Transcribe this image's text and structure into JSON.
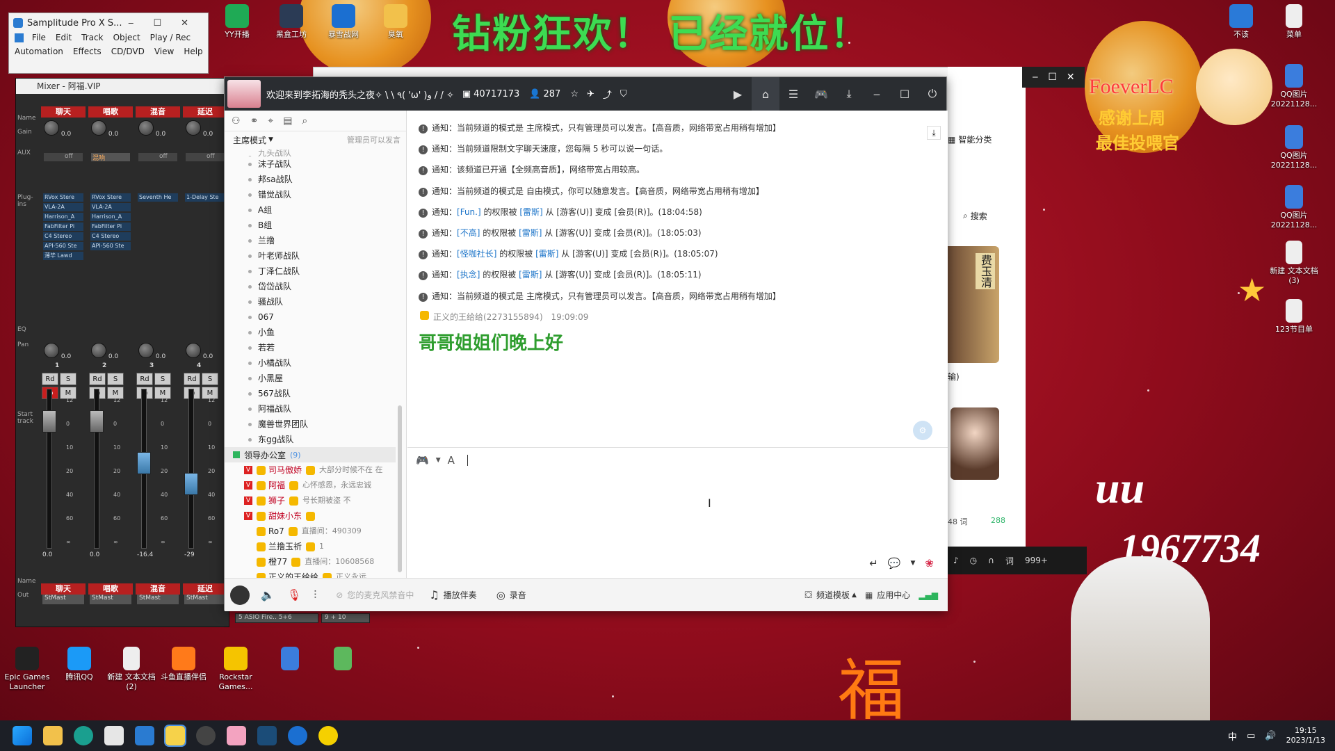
{
  "banner": {
    "text": "钻粉狂欢！ 已经就位！"
  },
  "overlay": {
    "name": "FoeverLC",
    "line1": "感谢上周",
    "line2": "最佳投喂官",
    "big_text1": "uu",
    "big_text2": "1967734",
    "fu": "福"
  },
  "desktop_top": [
    {
      "label": "YY开播",
      "color": "#1faa55"
    },
    {
      "label": "黑盒工坊",
      "color": "#2b3b55"
    },
    {
      "label": "暴雪战网",
      "color": "#1b6fd1"
    },
    {
      "label": "臭氧",
      "color": "#f2c14b"
    }
  ],
  "desktop_right": [
    {
      "label": "不该",
      "color": "#2a7ad8"
    },
    {
      "label": "菜单",
      "color": "#eeeeee"
    },
    {
      "label": "QQ图片20221128...",
      "color": "#3b7ddd"
    },
    {
      "label": "QQ图片20221128...",
      "color": "#3b7ddd"
    },
    {
      "label": "QQ图片20221128...",
      "color": "#3b7ddd"
    },
    {
      "label": "新建 文本文档 (3)",
      "color": "#eeeeee"
    },
    {
      "label": "123节目单",
      "color": "#eeeeee"
    }
  ],
  "desktop_bottom": [
    {
      "label": "Epic Games Launcher",
      "color": "#222222"
    },
    {
      "label": "腾讯QQ",
      "color": "#1b9af7"
    },
    {
      "label": "新建 文本文档 (2)",
      "color": "#eeeeee"
    },
    {
      "label": "斗鱼直播伴侣",
      "color": "#ff7a1a"
    },
    {
      "label": "Rockstar Games...",
      "color": "#f5c400"
    },
    {
      "label": "",
      "color": "#3b7ddd"
    },
    {
      "label": "",
      "color": "#5db85d"
    }
  ],
  "samplitude": {
    "title": "Samplitude Pro X S...",
    "menu1": [
      "File",
      "Edit",
      "Track",
      "Object",
      "Play / Rec"
    ],
    "menu2": [
      "Automation",
      "Effects",
      "CD/DVD",
      "View",
      "Help"
    ]
  },
  "mixer": {
    "title": "Mixer - 阿福.VIP",
    "side_labels": [
      "Name",
      "Gain",
      "AUX",
      "Plug-ins",
      "EQ",
      "Pan",
      "Start track",
      "Name",
      "Out"
    ],
    "strips": [
      {
        "name": "聊天",
        "num": "1",
        "gain": "0.0",
        "pan": "0.0",
        "plugins": [
          "RVox Stere",
          "VLA-2A",
          "Harrison_A",
          "FabFilter Pi",
          "C4 Stereo",
          "API-560 Ste",
          "薄毕 Lawd"
        ],
        "aux": "off",
        "scale_top": "12",
        "db": "0.0",
        "out": "StMast",
        "fader": 0.6
      },
      {
        "name": "唱歌",
        "num": "2",
        "gain": "0.0",
        "pan": "0.0",
        "plugins": [
          "RVox Stere",
          "VLA-2A",
          "Harrison_A",
          "FabFilter Pi",
          "C4 Stereo",
          "API-560 Ste"
        ],
        "aux": "混响",
        "scale_top": "12",
        "db": "0.0",
        "out": "StMast",
        "fader": 0.6
      },
      {
        "name": "混音",
        "num": "3",
        "gain": "0.0",
        "pan": "0.0",
        "plugins": [
          "Seventh He"
        ],
        "aux": "off",
        "scale_top": "12",
        "db": "-16.4",
        "out": "StMast",
        "fader": 0.4
      },
      {
        "name": "延迟",
        "num": "4",
        "gain": "0.0",
        "pan": "0.0",
        "plugins": [
          "1-Delay Ste"
        ],
        "aux": "off",
        "scale_top": "12",
        "db": "-29",
        "out": "StMast",
        "fader": 0.3
      }
    ],
    "outputs": [
      "5 ASIO Fire.. 5+6",
      "9 + 10"
    ]
  },
  "app": {
    "title": "欢迎来到李拓海的秃头之夜✧ \\ \\ ٩( 'ω' )و / / ✧",
    "id": "40717173",
    "users": "287",
    "mode": "主席模式",
    "mode_hint": "管理员可以发言",
    "channels": [
      "九头战队",
      "沫子战队",
      "邦sa战队",
      "错觉战队",
      "A组",
      "B组",
      "兰撸",
      "叶老师战队",
      "丁泽仁战队",
      "岱岱战队",
      "骚战队",
      "067",
      "小鱼",
      "若若",
      "小橘战队",
      "小黑屋",
      "567战队",
      "阿福战队",
      "魔兽世界团队",
      "东gg战队"
    ],
    "group": {
      "name": "领导办公室",
      "count": "(9)"
    },
    "users_list": [
      {
        "name": "司马傲娇",
        "status": "大部分时候不在 在"
      },
      {
        "name": "阿福",
        "status": "心怀感恩，永远忠诚"
      },
      {
        "name": "狮子",
        "status": "号长期被盗 不"
      },
      {
        "name": "甜妹小东",
        "status": ""
      },
      {
        "name": "Ro7",
        "status": "直播间：490309"
      },
      {
        "name": "兰撸玉祈",
        "status": "1"
      },
      {
        "name": "橙77",
        "status": "直播间：10608568"
      },
      {
        "name": "正义的王给给",
        "status": "正义永远"
      }
    ],
    "notices": [
      {
        "p1": "通知：当前频道的模式是 主席模式，只有管理员可以发言。【高音质，网络带宽占用稍有增加】"
      },
      {
        "p1": "通知：当前频道限制文字聊天速度，您每隔 5 秒可以说一句话。"
      },
      {
        "p1": "通知：该频道已开通【全频高音质】，网络带宽占用较高。"
      },
      {
        "p1": "通知：当前频道的模式是 自由模式，你可以随意发言。【高音质，网络带宽占用稍有增加】"
      },
      {
        "p1": "通知：",
        "l1": "[Fun.]",
        "p2": "的权限被",
        "l2": "[雷斯]",
        "p3": "从 [游客(U)] 变成 [会员(R)]。(18:04:58)"
      },
      {
        "p1": "通知：",
        "l1": "[不高]",
        "p2": "的权限被",
        "l2": "[雷斯]",
        "p3": "从 [游客(U)] 变成 [会员(R)]。(18:05:03)"
      },
      {
        "p1": "通知：",
        "l1": "[怪咖社长]",
        "p2": "的权限被",
        "l2": "[雷斯]",
        "p3": "从 [游客(U)] 变成 [会员(R)]。(18:05:07)"
      },
      {
        "p1": "通知：",
        "l1": "[执念]",
        "p2": "的权限被",
        "l2": "[雷斯]",
        "p3": "从 [游客(U)] 变成 [会员(R)]。(18:05:11)"
      },
      {
        "p1": "通知：当前频道的模式是 主席模式，只有管理员可以发言。【高音质，网络带宽占用稍有增加】"
      }
    ],
    "chat_sender": "正义的王给给(2273155894)",
    "chat_time": "19:09:09",
    "chat_message": "哥哥姐姐们晚上好",
    "bottom": {
      "mic_hint": "您的麦克风禁音中",
      "music": "播放伴奏",
      "record": "录音",
      "template": "频道模板",
      "app_center": "应用中心"
    }
  },
  "right_panel": {
    "category": "智能分类",
    "search": "搜索",
    "album_text": "费玉清",
    "transport": "输)",
    "count_a": "48 词",
    "count_b": "288",
    "count_c": "999+"
  },
  "taskbar": {
    "lang": "中",
    "time": "19:15",
    "date": "2023/1/13"
  },
  "colors": {
    "accent_red": "#b72020",
    "link_blue": "#1a73c8",
    "chat_green": "#2e9d2e",
    "banner_green": "#3ddc52"
  }
}
